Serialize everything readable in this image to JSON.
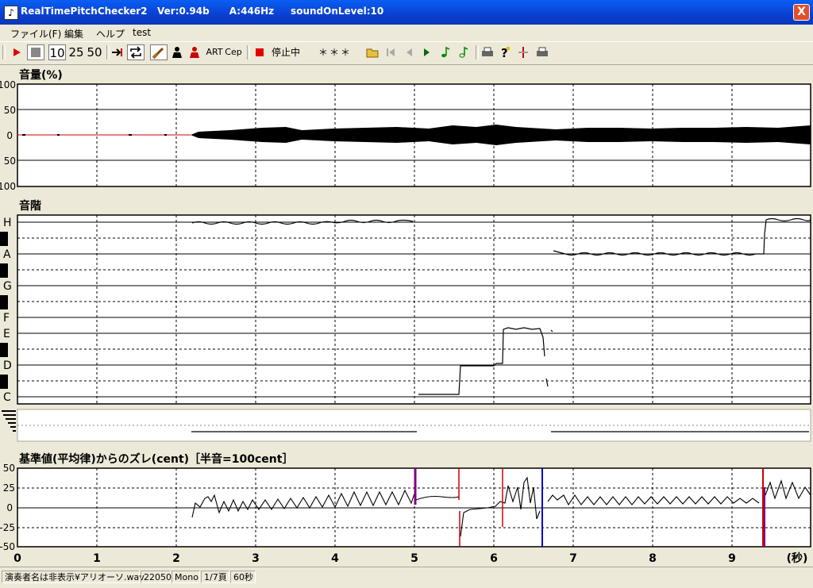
{
  "window": {
    "title": "RealTimePitchChecker2   Ver:0.94b      A:446Hz     soundOnLevel:10",
    "close_label": "X"
  },
  "menu": [
    "ファイル(F)",
    "編集",
    "ヘルプ",
    "test"
  ],
  "toolbar": {
    "play_icon": "play-icon",
    "stop_icon": "stop-icon",
    "zoom_options": [
      "10",
      "25",
      "50"
    ],
    "art_label": "ART",
    "cep_label": "Cep",
    "status_text": "停止中",
    "note_display": "＊＊＊"
  },
  "volume_panel": {
    "title": "音量(%)",
    "ticks": [
      "100",
      "50",
      "0",
      "50",
      "100"
    ]
  },
  "scale_panel": {
    "title": "音階",
    "notes": [
      "H",
      "A",
      "G",
      "F",
      "E",
      "D",
      "C"
    ]
  },
  "deviation_panel": {
    "title": "基準値(平均律)からのズレ(cent)［半音=100cent］",
    "ticks": [
      "50",
      "25",
      "0",
      "-25",
      "-50"
    ]
  },
  "time_axis": {
    "ticks": [
      "0",
      "1",
      "2",
      "3",
      "4",
      "5",
      "6",
      "7",
      "8",
      "9"
    ],
    "unit": "(秒)"
  },
  "status": {
    "file": "演奏者名は非表示¥アリオーソ.wav",
    "rate": "22050",
    "channels": "Mono",
    "page": "1/7頁",
    "duration": "60秒"
  },
  "colors": {
    "plot_bg": "#ffffff",
    "trace": "#000000",
    "marker_red": "#cc0000",
    "marker_purple": "#800080",
    "marker_blue": "#0000cc"
  }
}
